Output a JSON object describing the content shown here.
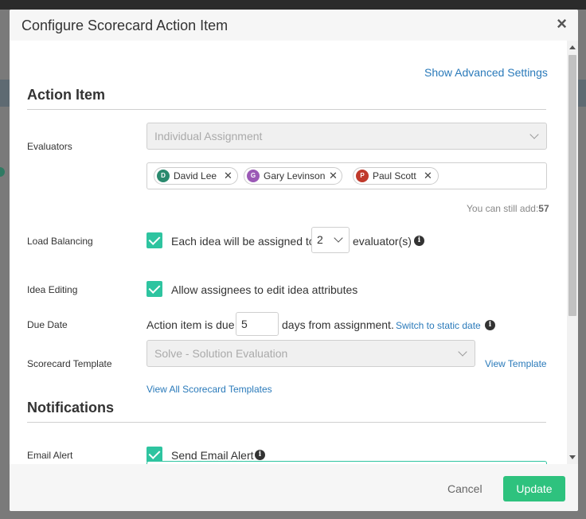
{
  "dialog": {
    "title": "Configure Scorecard Action Item",
    "close_glyph": "×",
    "advanced_link": "Show Advanced Settings"
  },
  "action_item": {
    "section_title": "Action Item",
    "evaluators": {
      "label": "Evaluators",
      "assignment_value": "Individual Assignment",
      "assignees": [
        {
          "initial": "D",
          "name": "David Lee",
          "color": "#2a8a6e"
        },
        {
          "initial": "G",
          "name": "Gary Levinson",
          "color": "#9b59b6"
        },
        {
          "initial": "P",
          "name": "Paul Scott",
          "color": "#c0392b"
        }
      ],
      "remove_glyph": "✕",
      "remaining_label": "You can still add:",
      "remaining_count": "57"
    },
    "load_balancing": {
      "label": "Load Balancing",
      "checked": true,
      "text_before": "Each idea will be assigned to",
      "value": "2",
      "text_after": "evaluator(s)"
    },
    "idea_editing": {
      "label": "Idea Editing",
      "checked": true,
      "text": "Allow assignees to edit idea attributes"
    },
    "due_date": {
      "label": "Due Date",
      "text_before": "Action item is due",
      "value": "5",
      "text_after": "days from assignment.",
      "switch_link": "Switch to static date"
    },
    "scorecard_template": {
      "label": "Scorecard Template",
      "value": "Solve - Solution Evaluation",
      "view_link": "View Template",
      "view_all_link": "View All Scorecard Templates"
    }
  },
  "notifications": {
    "section_title": "Notifications",
    "email_alert": {
      "label": "Email Alert",
      "checked": true,
      "text": "Send Email Alert"
    }
  },
  "footer": {
    "cancel_label": "Cancel",
    "update_label": "Update"
  },
  "colors": {
    "accent_green": "#2ec27e",
    "checkbox_teal": "#2ec4a0",
    "link_blue": "#2a7aba"
  }
}
